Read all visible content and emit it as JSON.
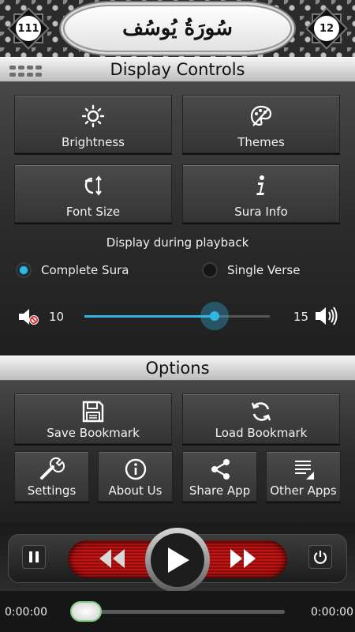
{
  "header": {
    "title": "سُورَةُ يُوسُف",
    "prev_sura_number": "111",
    "next_sura_number": "12"
  },
  "display_controls": {
    "title": "Display Controls",
    "brightness_label": "Brightness",
    "themes_label": "Themes",
    "font_size_label": "Font Size",
    "sura_info_label": "Sura Info",
    "playback_label": "Display during playback",
    "complete_sura_label": "Complete Sura",
    "single_verse_label": "Single Verse",
    "selected_option": "Complete Sura",
    "volume_min": "10",
    "volume_max": "15",
    "volume_level_fraction": 0.7
  },
  "options": {
    "title": "Options",
    "save_bookmark_label": "Save Bookmark",
    "load_bookmark_label": "Load Bookmark",
    "settings_label": "Settings",
    "about_us_label": "About Us",
    "share_app_label": "Share App",
    "other_apps_label": "Other Apps"
  },
  "player": {
    "elapsed": "0:00:00",
    "total": "0:00:00",
    "progress_fraction": 0
  },
  "colors": {
    "accent": "#33b5e5",
    "player_red": "#c01616"
  },
  "icons": {
    "brightness": "sun-icon",
    "themes": "palette-icon",
    "font_size": "font-size-icon",
    "sura_info": "info-icon",
    "save": "floppy-disk-icon",
    "load": "refresh-icon",
    "settings": "wrench-icon",
    "about": "info-circle-icon",
    "share": "share-icon",
    "other_apps": "list-icon"
  }
}
